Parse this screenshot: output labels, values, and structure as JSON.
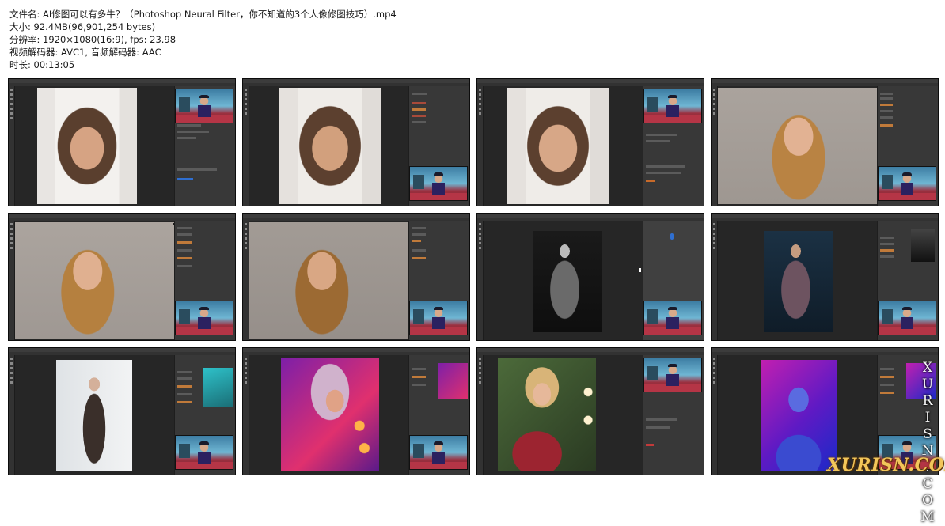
{
  "file_info": {
    "filename": "文件名: AI修图可以有多牛？（Photoshop Neural Filter，你不知道的3个人像修图技巧）.mp4",
    "size": "大小: 92.4MB(96,901,254 bytes)",
    "resolution": "分辨率: 1920×1080(16:9), fps: 23.98",
    "codec": "视频解码器: AVC1, 音频解码器: AAC",
    "duration": "时长: 00:13:05"
  },
  "watermark": {
    "vertical_text": "XURISN.COM",
    "bottom_text": "XURISN.COM"
  },
  "thumbnails": [
    {
      "photo": "girl-headscarf",
      "webcam": "top"
    },
    {
      "photo": "girl-headscarf",
      "webcam": "bottom"
    },
    {
      "photo": "girl-headscarf",
      "webcam": "top"
    },
    {
      "photo": "redhead-smiling",
      "webcam": "bottom"
    },
    {
      "photo": "redhead-smiling",
      "webcam": "bottom"
    },
    {
      "photo": "redhead-smiling",
      "webcam": "bottom"
    },
    {
      "photo": "veil-woman-bw",
      "webcam": "bottom"
    },
    {
      "photo": "veil-woman-color",
      "webcam": "bottom"
    },
    {
      "photo": "woman-hijab-wall",
      "webcam": "bottom"
    },
    {
      "photo": "neon-blonde",
      "webcam": "bottom"
    },
    {
      "photo": "blonde-lights",
      "webcam": "top"
    },
    {
      "photo": "blue-purple-portrait",
      "webcam": "bottom"
    }
  ],
  "colors": {
    "ps_background": "#2a2a2a",
    "ps_panel": "#383838",
    "accent_blue": "#2f7be0",
    "watermark_gold": "#f2c65a"
  }
}
